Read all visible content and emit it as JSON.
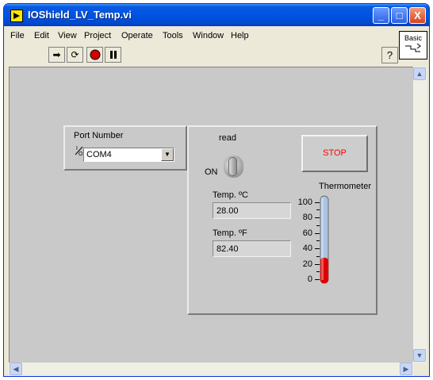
{
  "window": {
    "title": "IOShield_LV_Temp.vi"
  },
  "title_buttons": {
    "minimize": "_",
    "maximize": "□",
    "close": "X"
  },
  "menu": [
    "File",
    "Edit",
    "View",
    "Project",
    "Operate",
    "Tools",
    "Window",
    "Help"
  ],
  "toolbar": {
    "icons": [
      "run-icon",
      "run-continuously-icon",
      "abort-icon",
      "pause-icon"
    ],
    "help_label": "?"
  },
  "palette": {
    "label": "Basic"
  },
  "port": {
    "label": "Port Number",
    "ring_glyph": "I/O",
    "value": "COM4"
  },
  "switch": {
    "label": "read",
    "state_label": "ON",
    "state": "on"
  },
  "stop": {
    "label": "STOP"
  },
  "temp_c": {
    "label": "Temp. ºC",
    "value": "28.00"
  },
  "temp_f": {
    "label": "Temp. ºF",
    "value": "82.40"
  },
  "thermometer": {
    "label": "Thermometer",
    "min": 0,
    "max": 100,
    "ticks": [
      "100",
      "80",
      "60",
      "40",
      "20",
      "0"
    ],
    "level": 28,
    "fill_color": "#e00000",
    "empty_color": "#a9c4e6"
  },
  "colors": {
    "panel": "#c9c9c9",
    "stop_text": "#ff0000",
    "titlebar": "#0054e3"
  }
}
